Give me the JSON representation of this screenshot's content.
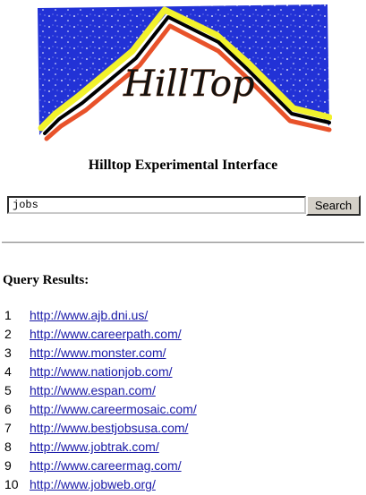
{
  "logo": {
    "text": "HillTop"
  },
  "heading": "Hilltop Experimental Interface",
  "search": {
    "query": "jobs",
    "button_label": "Search"
  },
  "results_title": "Query Results:",
  "results": [
    {
      "num": "1",
      "url": "http://www.ajb.dni.us/"
    },
    {
      "num": "2",
      "url": "http://www.careerpath.com/"
    },
    {
      "num": "3",
      "url": "http://www.monster.com/"
    },
    {
      "num": "4",
      "url": "http://www.nationjob.com/"
    },
    {
      "num": "5",
      "url": "http://www.espan.com/"
    },
    {
      "num": "6",
      "url": "http://www.careermosaic.com/"
    },
    {
      "num": "7",
      "url": "http://www.bestjobsusa.com/"
    },
    {
      "num": "8",
      "url": "http://www.jobtrak.com/"
    },
    {
      "num": "9",
      "url": "http://www.careermag.com/"
    },
    {
      "num": "10",
      "url": "http://www.jobweb.org/"
    }
  ],
  "colors": {
    "link": "#1a1aa8",
    "sky": "#1e2fd8",
    "ridge_yellow": "#f2f22c",
    "ridge_red": "#e8522a"
  }
}
